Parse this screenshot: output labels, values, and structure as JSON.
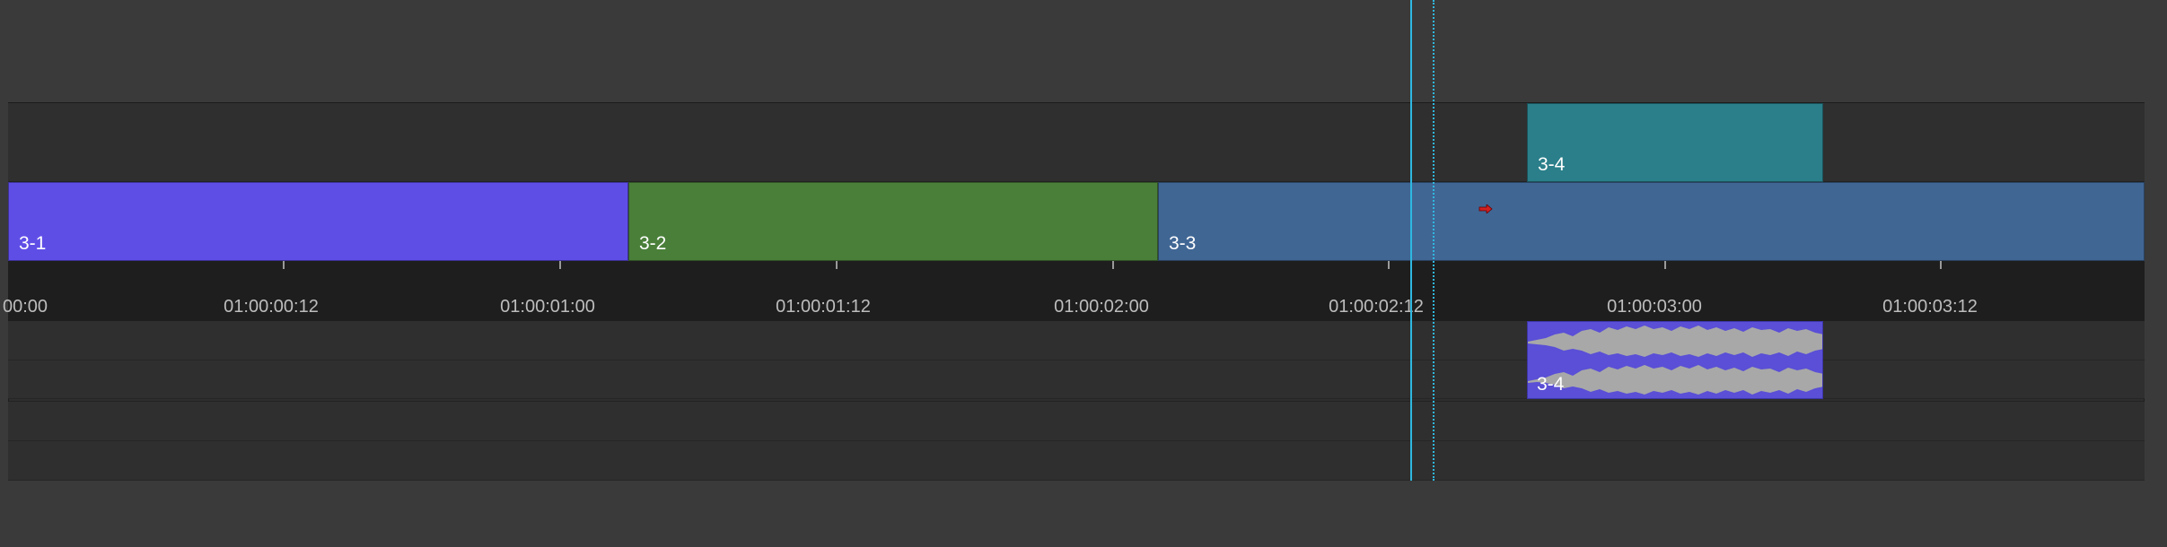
{
  "clips": {
    "c31": {
      "label": "3-1",
      "color": "#5f4ee6"
    },
    "c32": {
      "label": "3-2",
      "color": "#4a7f3a"
    },
    "c33": {
      "label": "3-3",
      "color": "#406694"
    },
    "c34": {
      "label": "3-4",
      "color": "#2a7f8a"
    }
  },
  "audio_clip": {
    "label": "3-4",
    "color": "#5a4fd6"
  },
  "ruler": {
    "labels": [
      "00:00",
      "01:00:00:12",
      "01:00:01:00",
      "01:00:01:12",
      "01:00:02:00",
      "01:00:02:12",
      "01:00:03:00",
      "01:00:03:12"
    ]
  },
  "colors": {
    "playhead": "#2fb8e0",
    "background": "#3a3a3a"
  },
  "icons": {
    "marker": "marker-arrow-icon"
  }
}
